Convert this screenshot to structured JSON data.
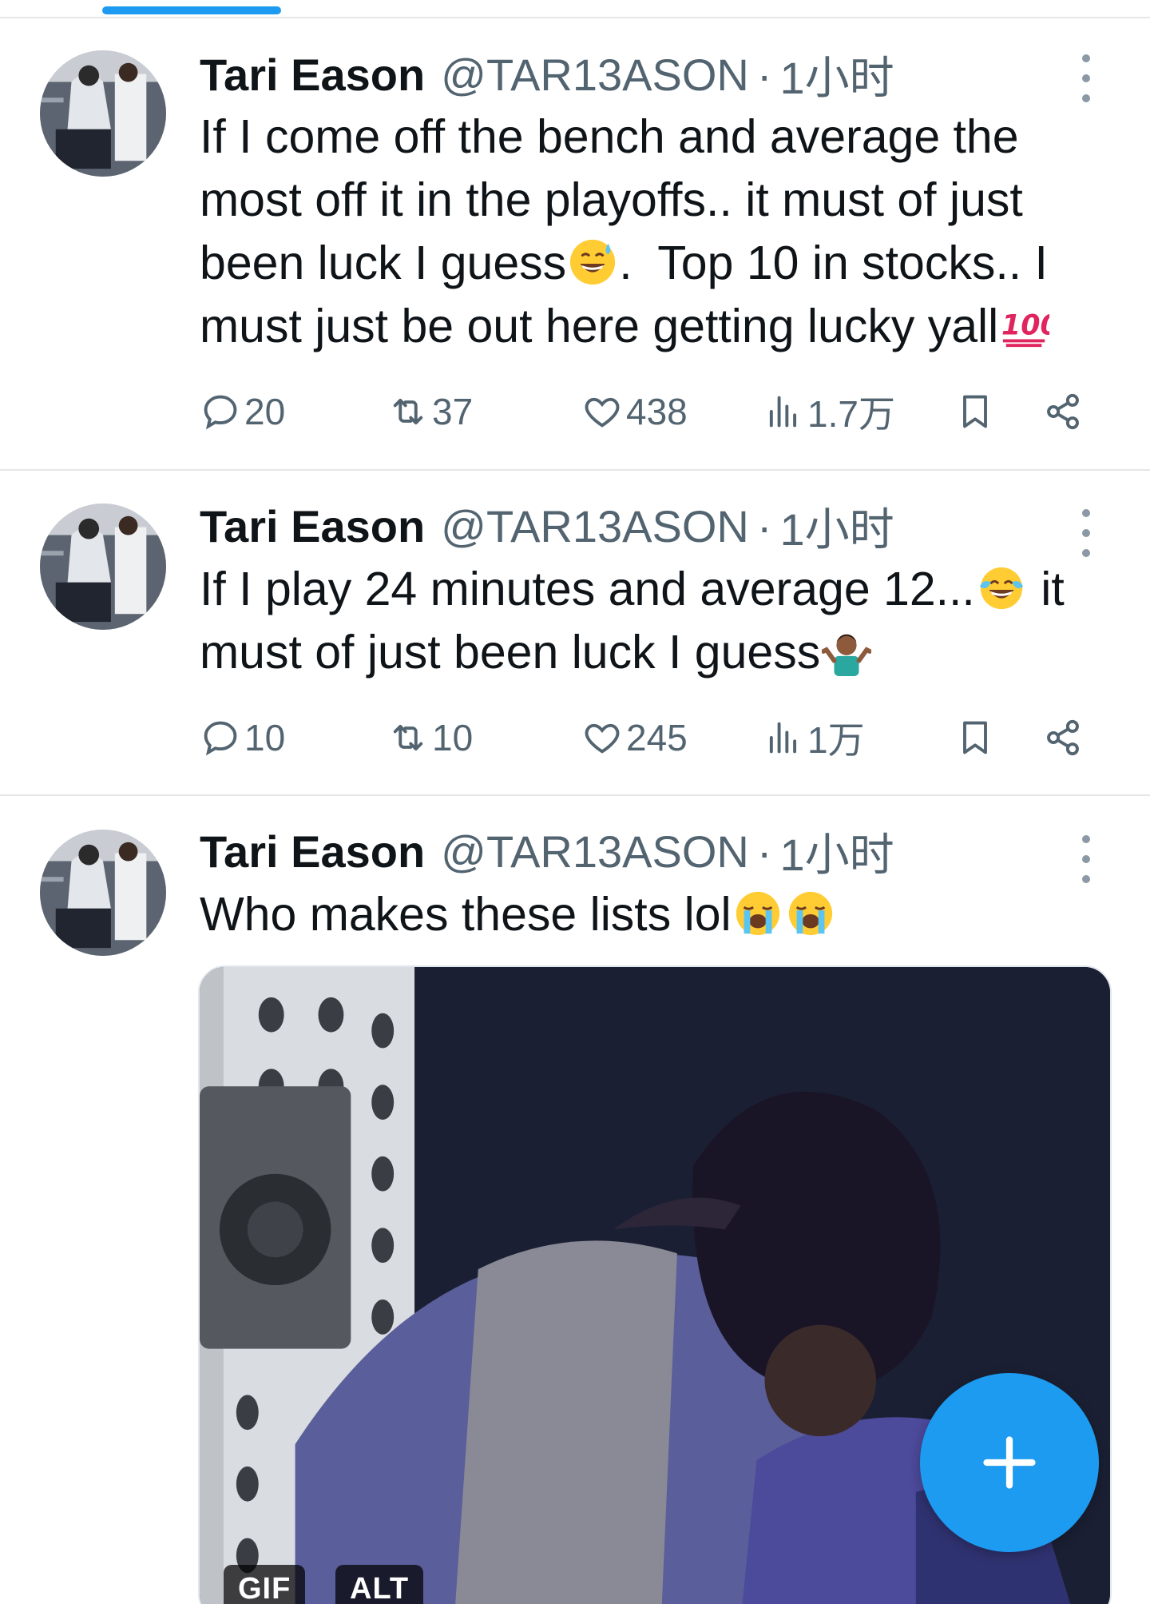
{
  "tweets": [
    {
      "name": "Tari Eason",
      "handle": "@TAR13ASON",
      "separator": "·",
      "time": "1小时",
      "text_parts": [
        "If I come off the bench and average the most off it in the playoffs.. it must of just been luck I guess",
        ".  Top 10 in stocks.. I must just be out here getting lucky yall"
      ],
      "emojis": [
        "sweat-smile-emoji",
        "hundred-points-emoji"
      ],
      "replies": "20",
      "retweets": "37",
      "likes": "438",
      "views": "1.7万"
    },
    {
      "name": "Tari Eason",
      "handle": "@TAR13ASON",
      "separator": "·",
      "time": "1小时",
      "text_parts": [
        "If I play 24 minutes and average 12...",
        " it must of just been luck I guess"
      ],
      "emojis": [
        "tears-of-joy-emoji",
        "person-shrugging-emoji"
      ],
      "replies": "10",
      "retweets": "10",
      "likes": "245",
      "views": "1万"
    },
    {
      "name": "Tari Eason",
      "handle": "@TAR13ASON",
      "separator": "·",
      "time": "1小时",
      "text_parts": [
        "Who makes these lists lol"
      ],
      "emojis": [
        "loudly-crying-emoji",
        "loudly-crying-emoji"
      ],
      "media": {
        "badges": [
          "GIF",
          "ALT"
        ]
      }
    }
  ],
  "colors": {
    "accent": "#1d9bf0",
    "secondary_text": "#536471",
    "divider": "#e6e6e6"
  }
}
